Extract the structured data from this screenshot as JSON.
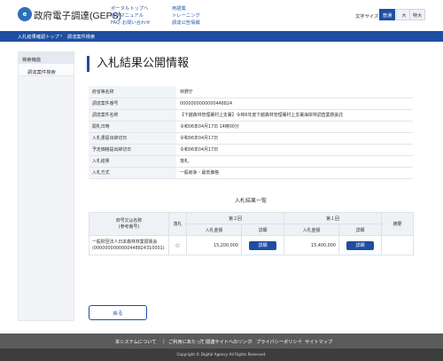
{
  "header": {
    "logo_text": "e",
    "site_title": "政府電子調達(GEPS)",
    "links": [
      "ポータルトップへ",
      "操作マニュアル",
      "FAQ･お問い合わせ",
      "用語集",
      "トレーニング",
      "調達公告情報"
    ],
    "font_size_label": "文字サイズ",
    "font_sizes": [
      "普通",
      "大",
      "特大"
    ],
    "font_size_selected": "普通"
  },
  "breadcrumb": [
    "入札結果確認トップ",
    "調達案件検索"
  ],
  "sidebar": {
    "heading": "検索機能",
    "items": [
      "調達案件検索"
    ]
  },
  "page_title": "入札結果公開情報",
  "details": [
    {
      "label": "府省等名称",
      "value": "林野庁"
    },
    {
      "label": "調達案件番号",
      "value": "0000000000000448824"
    },
    {
      "label": "調達案件名称",
      "value": "【下越森林管理署村上支署】令和6年度下越森林管理署村上支署海岸林調査業務委託"
    },
    {
      "label": "開札日時",
      "value": "令和06年04月17日 14時00分"
    },
    {
      "label": "入札書提出締切日",
      "value": "令和06年04月17日"
    },
    {
      "label": "予定価格提出締切日",
      "value": "令和06年04月17日"
    },
    {
      "label": "入札結果",
      "value": "落札"
    },
    {
      "label": "入札方式",
      "value": "一般競争・最低価格"
    }
  ],
  "results": {
    "title": "入札結果一覧",
    "col_name": "商号又は名称\n(参考番号)",
    "col_won": "落札",
    "round2": "第２回",
    "round1": "第１回",
    "col_amount": "入札金額",
    "col_detail": "詳細",
    "col_remarks": "摘要",
    "rows": [
      {
        "name": "一般財団法人日本森林林業振興会",
        "ref": "(0000000000000448824310001)",
        "won": "○",
        "amount2": "15,200,000",
        "amount1": "15,400,000",
        "detail_label": "詳細",
        "remarks": ""
      }
    ]
  },
  "back_button": "戻る",
  "footer": {
    "links": [
      "本システムについて",
      "ご利用にあたって",
      "関連サイトへのリンク",
      "プライバシーポリシー",
      "サイトマップ"
    ],
    "copyright": "Copyright © Digital Agency All Rights Reserved."
  }
}
